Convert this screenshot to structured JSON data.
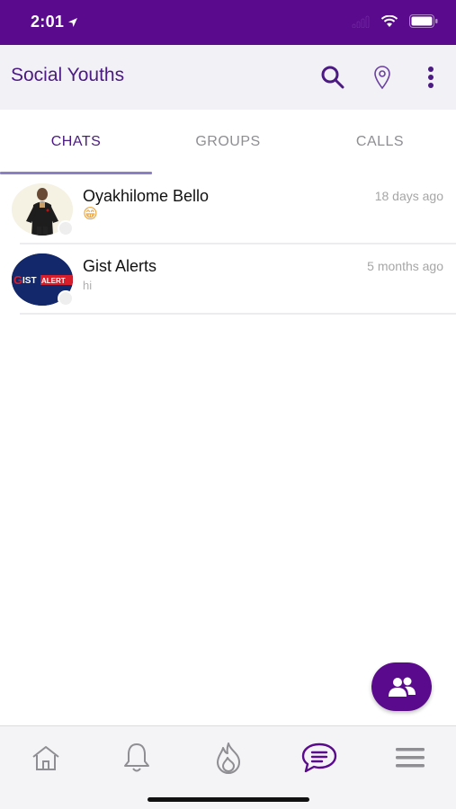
{
  "status_bar": {
    "time": "2:01"
  },
  "app_bar": {
    "title": "Social Youths",
    "actions": [
      "search-icon",
      "location-pin-icon",
      "more-vert-icon"
    ]
  },
  "tabs": [
    {
      "label": "CHATS",
      "active": true
    },
    {
      "label": "GROUPS",
      "active": false
    },
    {
      "label": "CALLS",
      "active": false
    }
  ],
  "chats": [
    {
      "name": "Oyakhilome Bello",
      "preview": "😁",
      "time": "18 days ago",
      "avatar": "person-photo"
    },
    {
      "name": "Gist Alerts",
      "preview": "hi",
      "time": "5 months ago",
      "avatar": "gist-alerts-logo",
      "avatar_text": "GISTALERT"
    }
  ],
  "fab": {
    "icon": "contacts-icon"
  },
  "bottom_nav": [
    {
      "icon": "home-icon",
      "active": false
    },
    {
      "icon": "bell-icon",
      "active": false
    },
    {
      "icon": "flame-icon",
      "active": false
    },
    {
      "icon": "chat-bubble-icon",
      "active": true
    },
    {
      "icon": "menu-icon",
      "active": false
    }
  ],
  "colors": {
    "brand": "#5a0a8c",
    "title": "#4b1a82",
    "inactive": "#8e8e93",
    "indicator": "#8a7fc3"
  }
}
